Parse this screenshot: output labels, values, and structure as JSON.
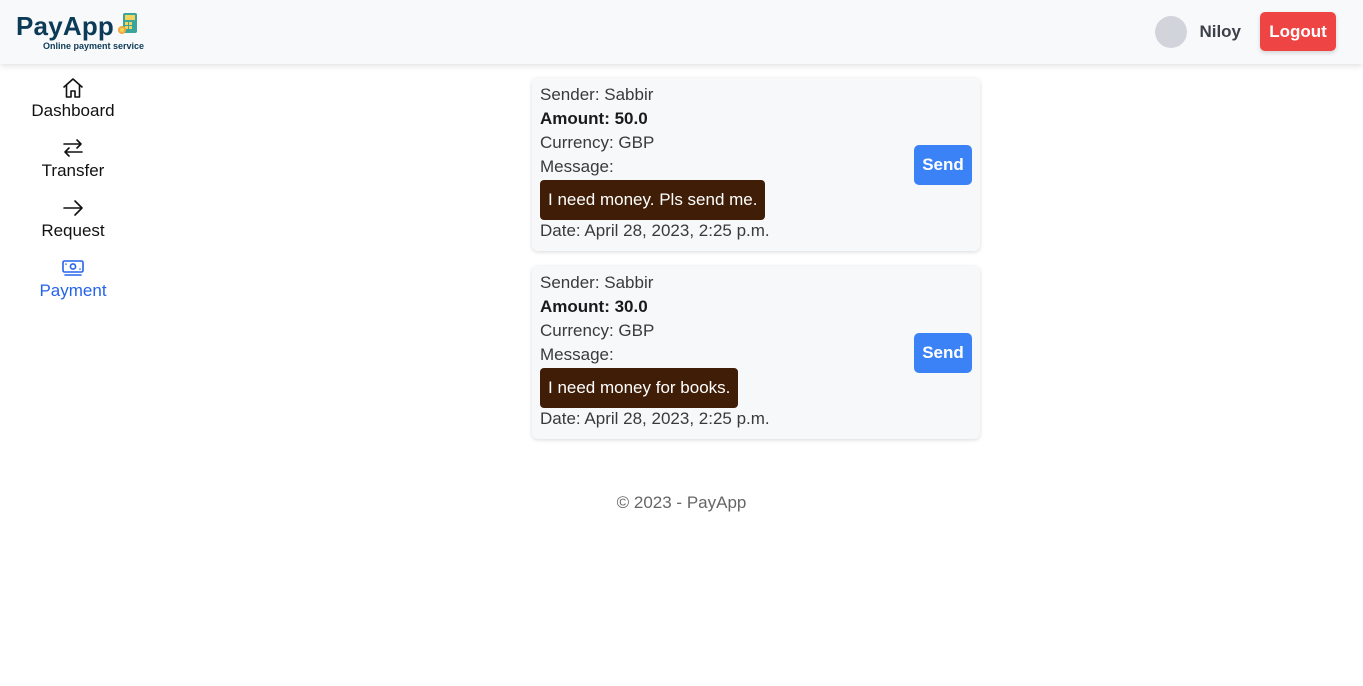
{
  "header": {
    "logo_text": "PayApp",
    "logo_tagline": "Online payment service",
    "user_name": "Niloy",
    "logout_label": "Logout"
  },
  "nav": {
    "items": [
      {
        "label": "Dashboard",
        "icon": "home-icon"
      },
      {
        "label": "Transfer",
        "icon": "transfer-arrows-icon"
      },
      {
        "label": "Request",
        "icon": "arrow-right-icon"
      },
      {
        "label": "Payment",
        "icon": "banknote-icon",
        "active": true
      }
    ]
  },
  "requests": [
    {
      "sender": "Sender: Sabbir",
      "amount": "Amount: 50.0",
      "currency": "Currency: GBP",
      "message_label": "Message:",
      "message": "I need money. Pls send me.",
      "date": "Date: April 28, 2023, 2:25 p.m.",
      "send_label": "Send"
    },
    {
      "sender": "Sender: Sabbir",
      "amount": "Amount: 30.0",
      "currency": "Currency: GBP",
      "message_label": "Message:",
      "message": "I need money for books.",
      "date": "Date: April 28, 2023, 2:25 p.m.",
      "send_label": "Send"
    }
  ],
  "footer": {
    "text": "© 2023 - PayApp"
  },
  "colors": {
    "brand": "#0c3b57",
    "logout": "#ef4444",
    "send": "#3b82f6",
    "active_nav": "#2563eb",
    "message_bubble": "#3f1d06"
  }
}
